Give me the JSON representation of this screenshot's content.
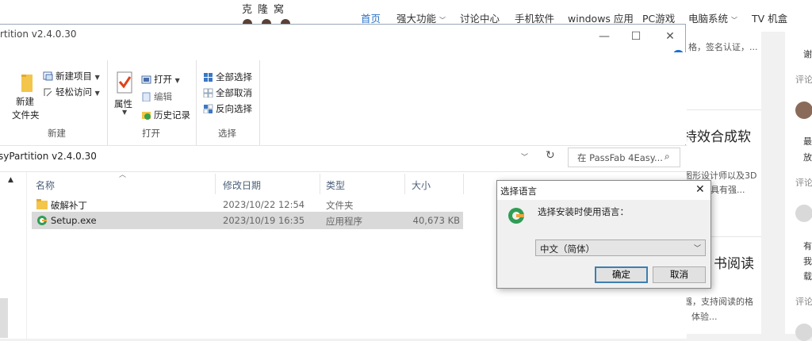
{
  "site": {
    "logo_text": "克隆窝",
    "nav": [
      "首页",
      "强大功能",
      "讨论中心",
      "手机软件",
      "windows 应用",
      "PC游戏",
      "电脑系统",
      "TV 机盒"
    ],
    "content": {
      "snippet1": "格，签名认证，...",
      "heading1": "持效合成软",
      "snippet2a": "图形设计师以及3D",
      "snippet2b": "具有强...",
      "heading2": "书阅读",
      "snippet3a": "器，支持阅读的格",
      "snippet3b": "体验..."
    },
    "sidebar": {
      "text1": "谢",
      "comment_label": "评论",
      "text2a": "最",
      "text2b": "放",
      "text3a": "有",
      "text3b": "我",
      "text3c": "载"
    }
  },
  "explorer": {
    "title": "rtition v2.4.0.30",
    "controls": {
      "minimize": "—",
      "maximize": "☐",
      "close": "✕"
    },
    "ribbon": {
      "new_group": {
        "new_item": "新建项目",
        "easy_access": "轻松访问",
        "new_folder_l1": "新建",
        "new_folder_l2": "文件夹",
        "label": "新建"
      },
      "open_group": {
        "properties": "属性",
        "open": "打开",
        "edit": "编辑",
        "history": "历史记录",
        "label": "打开"
      },
      "select_group": {
        "select_all": "全部选择",
        "select_none": "全部取消",
        "invert": "反向选择",
        "label": "选择"
      }
    },
    "address": {
      "path": "syPartition v2.4.0.30",
      "search_placeholder": "在 PassFab 4Easy..."
    },
    "columns": {
      "name": "名称",
      "date": "修改日期",
      "type": "类型",
      "size": "大小"
    },
    "files": [
      {
        "name": "破解补丁",
        "date": "2023/10/22 12:54",
        "type": "文件夹",
        "size": ""
      },
      {
        "name": "Setup.exe",
        "date": "2023/10/19 16:35",
        "type": "应用程序",
        "size": "40,673 KB"
      }
    ]
  },
  "dialog": {
    "title": "选择语言",
    "prompt": "选择安装时使用语言：",
    "selected_language": "中文（简体）",
    "ok": "确定",
    "cancel": "取消"
  },
  "colors": {
    "accent": "#2d74c8",
    "selection": "#d9d9d9",
    "dialog_bg": "#f0f0f0"
  }
}
